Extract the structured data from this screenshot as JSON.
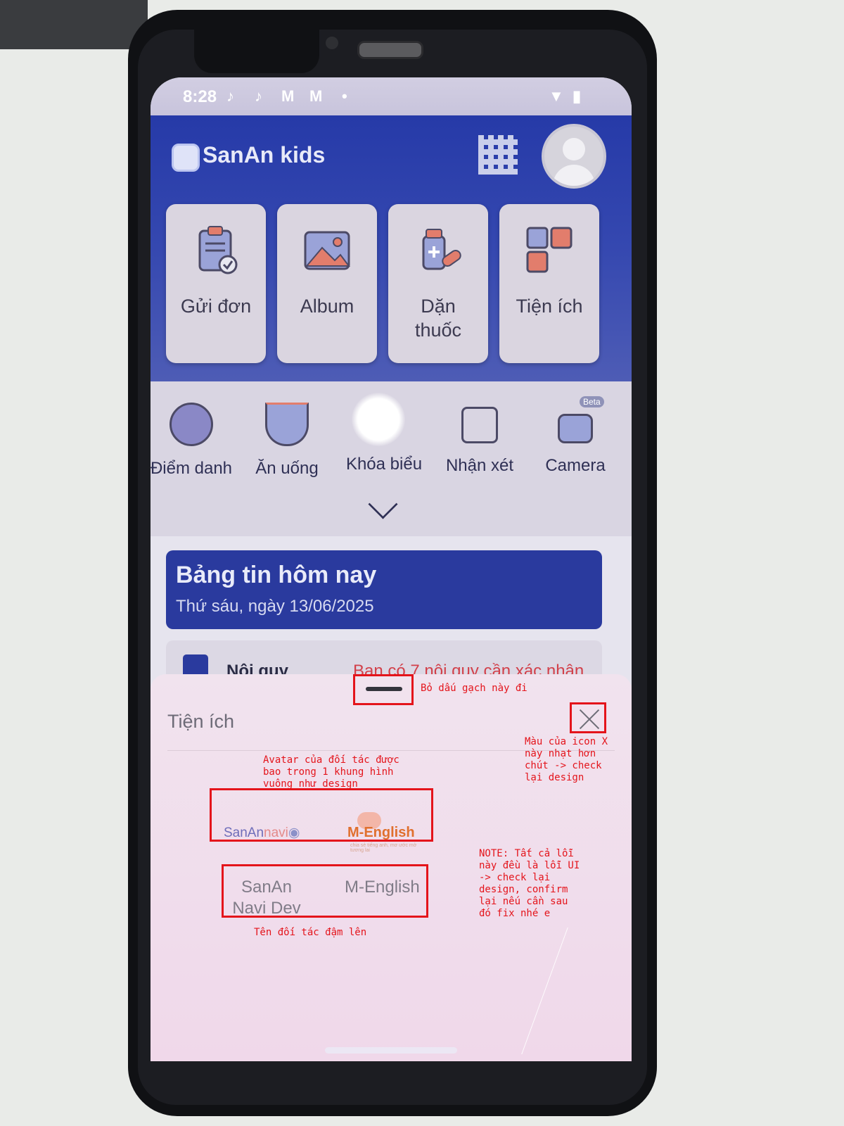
{
  "status_bar": {
    "time": "8:28",
    "icons": [
      "tiktok-icon",
      "tiktok-icon",
      "gmail-icon",
      "gmail-icon",
      "dot-icon",
      "wifi-icon",
      "battery-icon"
    ]
  },
  "header": {
    "app_name": "SanAn kids",
    "qr_icon": "qr-code-icon",
    "avatar_icon": "user-avatar-icon"
  },
  "quick_cards": [
    {
      "label": "Gửi đơn",
      "icon": "clipboard-check-icon"
    },
    {
      "label": "Album",
      "icon": "image-icon"
    },
    {
      "label": "Dặn thuốc",
      "icon": "medicine-icon"
    },
    {
      "label": "Tiện ích",
      "icon": "grid-apps-icon"
    }
  ],
  "menu": {
    "items": [
      {
        "label": "Điểm danh",
        "icon": "attendance-icon"
      },
      {
        "label": "Ăn uống",
        "icon": "food-bowl-icon"
      },
      {
        "label": "Khóa biểu",
        "icon": "schedule-icon"
      },
      {
        "label": "Nhận xét",
        "icon": "edit-note-icon"
      },
      {
        "label": "Camera",
        "icon": "camera-icon",
        "badge": "Beta"
      }
    ],
    "expand_icon": "chevron-down-icon"
  },
  "news": {
    "title": "Bảng tin hôm nay",
    "date": "Thứ sáu, ngày 13/06/2025"
  },
  "rule_row": {
    "label": "Nội quy",
    "value": "Bạn có 7 nội quy cần xác nhận"
  },
  "sheet": {
    "title": "Tiện ích",
    "partners": [
      {
        "logo_text": "SanAn",
        "logo_accent": "navi",
        "name": "SanAn Navi Dev"
      },
      {
        "logo_text": "M-English",
        "logo_tagline": "chia sẻ tiếng anh, mơ ước mở tương lai",
        "name": "M-English"
      }
    ]
  },
  "annotations": {
    "remove_handle": "Bỏ dấu gạch này đi",
    "close_color": "Màu của icon X\nnày nhạt hơn\nchút -> check\nlại design",
    "avatar_frame": "Avatar của đối tác được\nbao trong 1 khung hình\nvuông như design",
    "note": "NOTE: Tất cả lỗi\nnày đều là lỗi UI\n-> check lại\ndesign, confirm\nlại nếu cần sau\nđó fix nhé e",
    "bold_names": "Tên đối tác đậm lên"
  },
  "colors": {
    "header_blue": "#263aa8",
    "annotation_red": "#e4141b",
    "sheet_pink": "#f1e3ee"
  }
}
